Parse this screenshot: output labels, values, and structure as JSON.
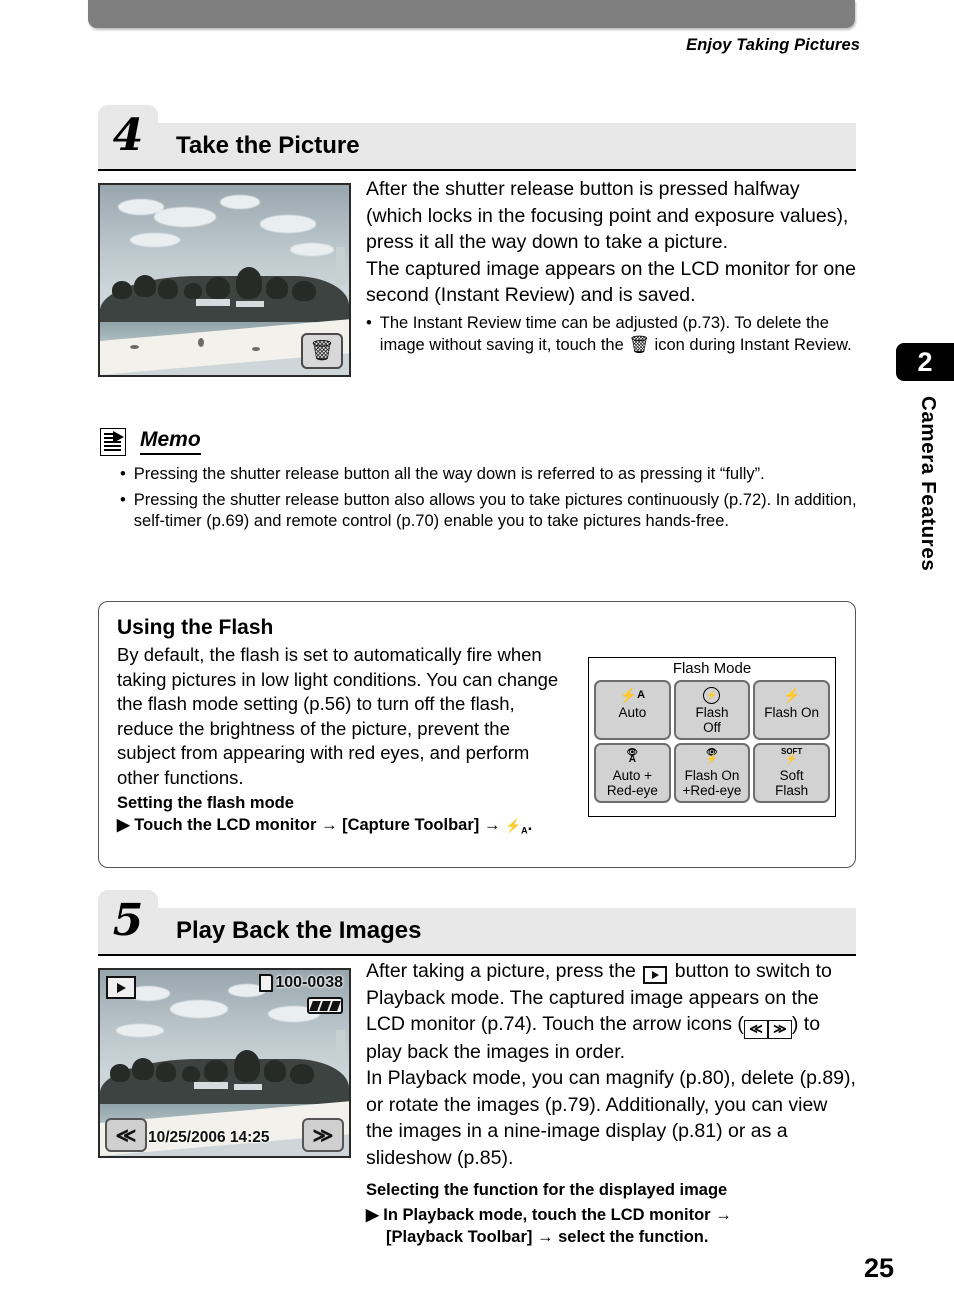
{
  "header": {
    "running_head": "Enjoy Taking Pictures"
  },
  "side_tab": {
    "chapter_number": "2",
    "chapter_label": "Camera Features"
  },
  "step4": {
    "number": "4",
    "title": "Take the Picture",
    "paragraph": "After the shutter release button is pressed halfway (which locks in the focusing point and exposure values), press it all the way down to take a picture.",
    "paragraph2": "The captured image appears on the LCD monitor for one second (Instant Review) and is saved.",
    "bullet_dot": "•",
    "bullet_part1": "The Instant Review time can be adjusted (p.73). To delete the image without saving it, touch the",
    "bullet_trash_icon": "trash-icon",
    "bullet_part2": "icon during Instant Review.",
    "lcd": {
      "trash_button_glyph": "🗑"
    }
  },
  "memo": {
    "icon": "memo-document-icon",
    "title": "Memo",
    "bullet_dot": "•",
    "items": [
      "Pressing the shutter release button all the way down is referred to as pressing it “fully”.",
      "Pressing the shutter release button also allows you to take pictures continuously (p.72). In addition, self-timer (p.69) and remote control (p.70) enable you to take pictures hands-free."
    ]
  },
  "flash_box": {
    "heading": "Using the Flash",
    "paragraph": "By default, the flash is set to automatically fire when taking pictures in low light conditions. You can change the flash mode setting (p.56) to turn off the flash, reduce the brightness of the picture, prevent the subject from appearing with red eyes, and perform other functions.",
    "subheading": "Setting the flash mode",
    "step_marker": "▶",
    "step_text_1": "Touch the LCD monitor",
    "arrow": "→",
    "step_text_2": "[Capture Toolbar]",
    "step_text_3": ".",
    "flash_auto_icon": "flash-auto-icon",
    "panel": {
      "title": "Flash Mode",
      "buttons": [
        {
          "icon": "flash-auto-icon",
          "icon_glyph": "⚡A",
          "label": "Auto"
        },
        {
          "icon": "flash-off-icon",
          "icon_glyph": "⊘",
          "label": "Flash\nOff"
        },
        {
          "icon": "flash-on-icon",
          "icon_glyph": "⚡",
          "label": "Flash On"
        },
        {
          "icon": "auto-red-eye-icon",
          "icon_glyph": "👁A",
          "label": "Auto +\nRed-eye"
        },
        {
          "icon": "flash-on-red-eye-icon",
          "icon_glyph": "👁⚡",
          "label": "Flash On\n+Red-eye"
        },
        {
          "icon": "soft-flash-icon",
          "icon_glyph": "SOFT⚡",
          "label": "Soft\nFlash"
        }
      ]
    }
  },
  "step5": {
    "number": "5",
    "title": "Play Back the Images",
    "text_1": "After taking a picture, press the",
    "playback_icon": "playback-button-icon",
    "text_2": "button to switch to Playback mode. The captured image appears on the LCD monitor (p.74). Touch the arrow icons (",
    "arrow_left_icon": "arrow-left-icon",
    "arrow_left_glyph": "≪",
    "arrow_right_icon": "arrow-right-icon",
    "arrow_right_glyph": "≫",
    "text_3": ") to play back the images in order.",
    "text_4": "In Playback mode, you can magnify (p.80), delete (p.89), or rotate the images (p.79). Additionally, you can view the images in a nine-image display (p.81) or as a slideshow (p.85).",
    "subheading": "Selecting the function for the displayed image",
    "step_marker": "▶",
    "step_text_1": "In Playback mode, touch the LCD monitor",
    "arrow": "→",
    "step_text_2": "[Playback Toolbar]",
    "step_text_3": "select the function.",
    "lcd": {
      "mode_icon": "playback-mode-icon",
      "card_icon": "memory-card-icon",
      "file_number": "100-0038",
      "battery_icon": "battery-full-icon",
      "arrow_prev": "≪",
      "arrow_next": "≫",
      "datetime": "10/25/2006  14:25"
    }
  },
  "footer": {
    "page_number": "25"
  }
}
